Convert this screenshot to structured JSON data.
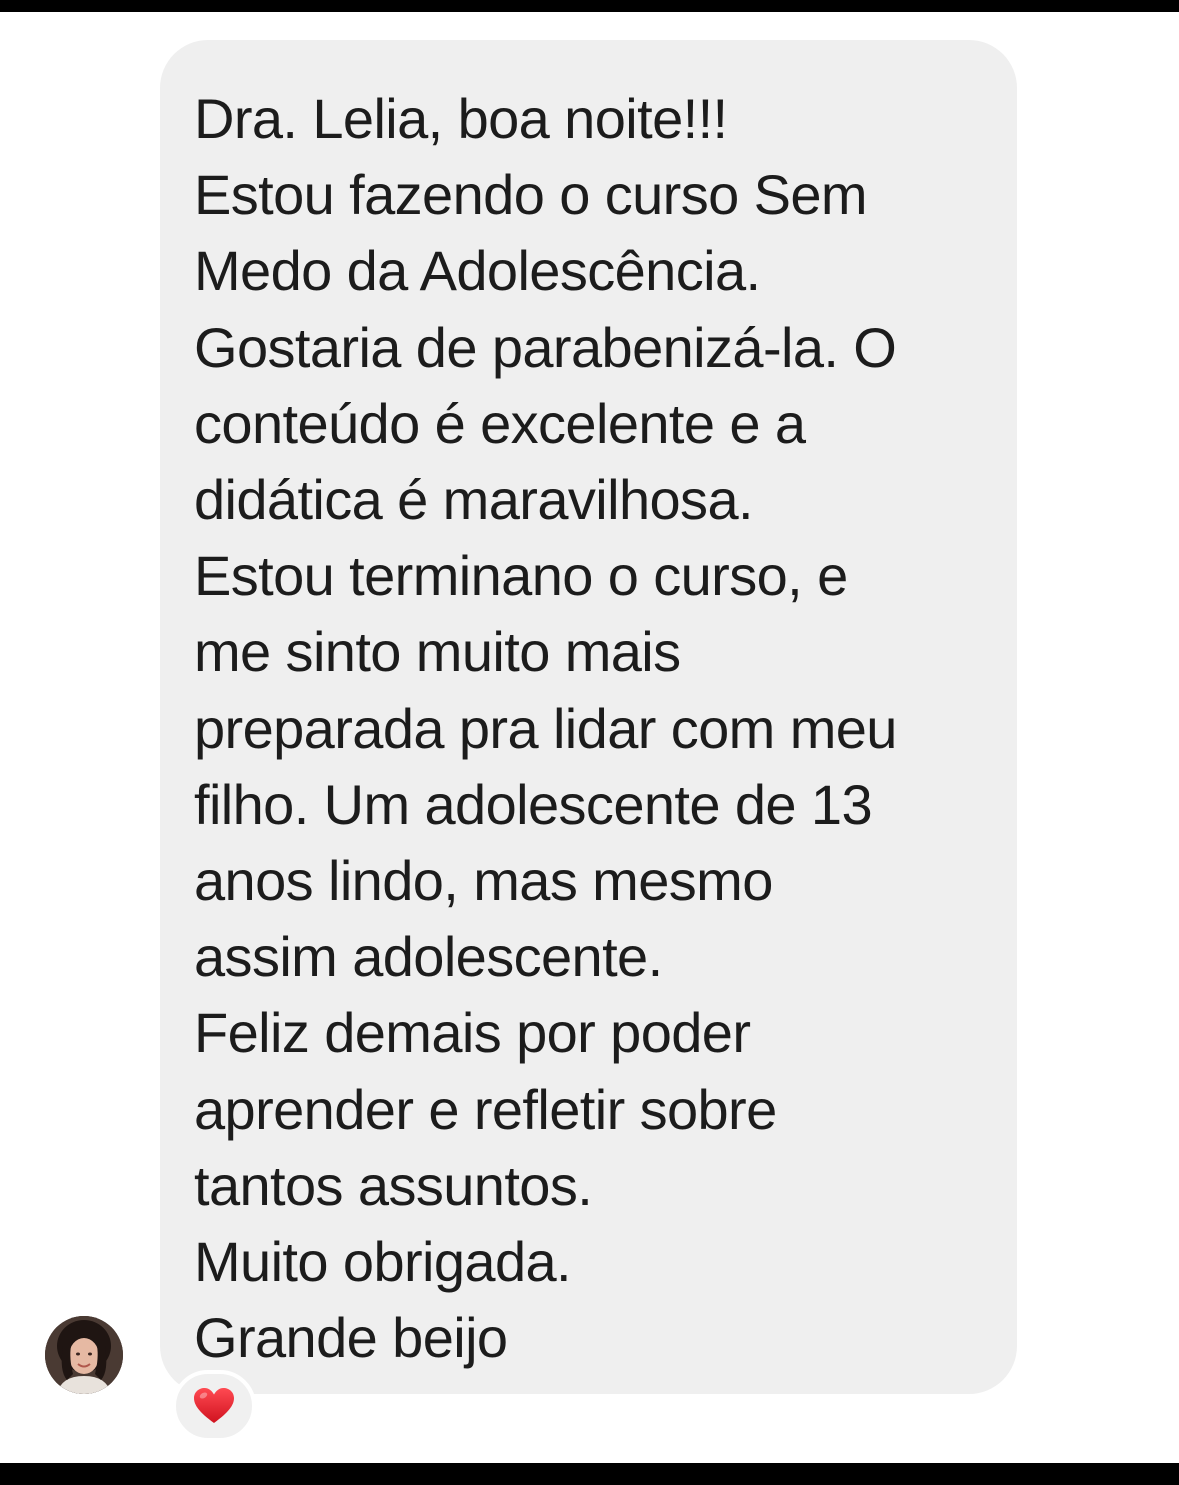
{
  "message": {
    "lines": [
      "Dra. Lelia, boa noite!!!",
      "Estou fazendo o curso Sem",
      "Medo da Adolescência.",
      "Gostaria de parabenizá-la. O",
      "conteúdo é excelente e a",
      "didática é maravilhosa.",
      "Estou terminano o curso, e",
      "me sinto muito mais",
      "preparada pra lidar com meu",
      "filho. Um adolescente de 13",
      "anos lindo, mas mesmo",
      "assim adolescente.",
      "Feliz demais por poder",
      "aprender e refletir sobre",
      "tantos assuntos.",
      "Muito obrigada.",
      "Grande beijo"
    ]
  },
  "sender": {
    "avatar_icon": "profile-photo"
  },
  "reaction": {
    "icon": "red-heart-icon",
    "color": "#e0202e"
  },
  "colors": {
    "bubble": "#efefef",
    "text": "#1c1c1c",
    "background": "#ffffff",
    "frame": "#000000"
  }
}
